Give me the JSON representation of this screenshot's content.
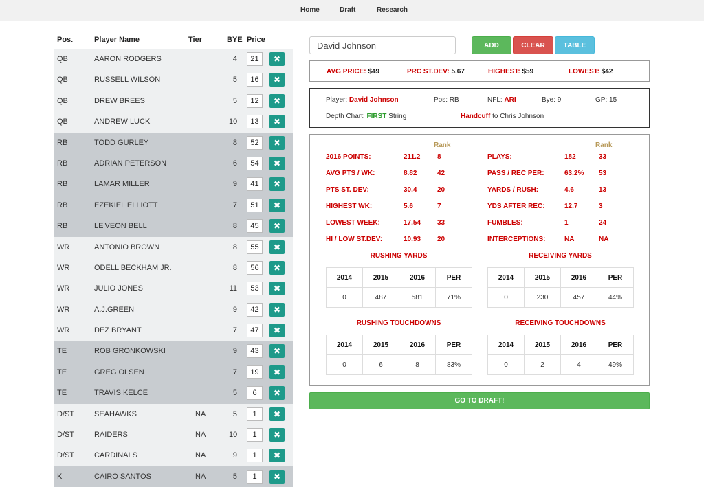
{
  "nav": {
    "home": "Home",
    "draft": "Draft",
    "research": "Research"
  },
  "table": {
    "headers": {
      "pos": "Pos.",
      "name": "Player Name",
      "tier": "Tier",
      "bye": "BYE",
      "price": "Price"
    },
    "delete_icon": "close-x-icon",
    "rows": [
      {
        "pos": "QB",
        "name": "AARON RODGERS",
        "tier": "",
        "bye": "4",
        "price": "21"
      },
      {
        "pos": "QB",
        "name": "RUSSELL WILSON",
        "tier": "",
        "bye": "5",
        "price": "16"
      },
      {
        "pos": "QB",
        "name": "DREW BREES",
        "tier": "",
        "bye": "5",
        "price": "12"
      },
      {
        "pos": "QB",
        "name": "ANDREW LUCK",
        "tier": "",
        "bye": "10",
        "price": "13"
      },
      {
        "pos": "RB",
        "name": "TODD GURLEY",
        "tier": "",
        "bye": "8",
        "price": "52"
      },
      {
        "pos": "RB",
        "name": "ADRIAN PETERSON",
        "tier": "",
        "bye": "6",
        "price": "54"
      },
      {
        "pos": "RB",
        "name": "LAMAR MILLER",
        "tier": "",
        "bye": "9",
        "price": "41"
      },
      {
        "pos": "RB",
        "name": "EZEKIEL ELLIOTT",
        "tier": "",
        "bye": "7",
        "price": "51"
      },
      {
        "pos": "RB",
        "name": "LE'VEON BELL",
        "tier": "",
        "bye": "8",
        "price": "45"
      },
      {
        "pos": "WR",
        "name": "ANTONIO BROWN",
        "tier": "",
        "bye": "8",
        "price": "55"
      },
      {
        "pos": "WR",
        "name": "ODELL BECKHAM JR.",
        "tier": "",
        "bye": "8",
        "price": "56"
      },
      {
        "pos": "WR",
        "name": "JULIO JONES",
        "tier": "",
        "bye": "11",
        "price": "53"
      },
      {
        "pos": "WR",
        "name": "A.J.GREEN",
        "tier": "",
        "bye": "9",
        "price": "42"
      },
      {
        "pos": "WR",
        "name": "DEZ BRYANT",
        "tier": "",
        "bye": "7",
        "price": "47"
      },
      {
        "pos": "TE",
        "name": "ROB GRONKOWSKI",
        "tier": "",
        "bye": "9",
        "price": "43"
      },
      {
        "pos": "TE",
        "name": "GREG OLSEN",
        "tier": "",
        "bye": "7",
        "price": "19"
      },
      {
        "pos": "TE",
        "name": "TRAVIS KELCE",
        "tier": "",
        "bye": "5",
        "price": "6"
      },
      {
        "pos": "D/ST",
        "name": "SEAHAWKS",
        "tier": "NA",
        "bye": "5",
        "price": "1"
      },
      {
        "pos": "D/ST",
        "name": "RAIDERS",
        "tier": "NA",
        "bye": "10",
        "price": "1"
      },
      {
        "pos": "D/ST",
        "name": "CARDINALS",
        "tier": "NA",
        "bye": "9",
        "price": "1"
      },
      {
        "pos": "K",
        "name": "CAIRO SANTOS",
        "tier": "NA",
        "bye": "5",
        "price": "1"
      }
    ]
  },
  "search": {
    "value": "David Johnson"
  },
  "buttons": {
    "add": "ADD",
    "clear": "CLEAR",
    "table": "TABLE",
    "go_to_draft": "GO TO DRAFT!"
  },
  "summary": {
    "avg_price_label": "AVG PRICE:",
    "avg_price": "$49",
    "prc_stdev_label": "PRC ST.DEV:",
    "prc_stdev": "5.67",
    "highest_label": "HIGHEST:",
    "highest": "$59",
    "lowest_label": "LOWEST:",
    "lowest": "$42"
  },
  "player_info": {
    "player_label": "Player:",
    "player": "David Johnson",
    "pos_label": "Pos:",
    "pos": "RB",
    "nfl_label": "NFL:",
    "nfl": "ARI",
    "bye_label": "Bye:",
    "bye": "9",
    "gp_label": "GP:",
    "gp": "15",
    "depth_label": "Depth Chart:",
    "depth": "FIRST",
    "depth_suffix": "String",
    "handcuff_label": "Handcuff",
    "handcuff_suffix": "to Chris Johnson"
  },
  "stats": {
    "rank_header": "Rank",
    "left": [
      {
        "label": "2016 POINTS:",
        "value": "211.2",
        "rank": "8"
      },
      {
        "label": "AVG PTS / WK:",
        "value": "8.82",
        "rank": "42"
      },
      {
        "label": "PTS ST. DEV:",
        "value": "30.4",
        "rank": "20"
      },
      {
        "label": "HIGHEST WK:",
        "value": "5.6",
        "rank": "7"
      },
      {
        "label": "LOWEST WEEK:",
        "value": "17.54",
        "rank": "33"
      },
      {
        "label": "HI / LOW ST.DEV:",
        "value": "10.93",
        "rank": "20"
      }
    ],
    "right": [
      {
        "label": "PLAYS:",
        "value": "182",
        "rank": "33"
      },
      {
        "label": "PASS / REC PER:",
        "value": "63.2%",
        "rank": "53"
      },
      {
        "label": "YARDS / RUSH:",
        "value": "4.6",
        "rank": "13"
      },
      {
        "label": "YDS AFTER REC:",
        "value": "12.7",
        "rank": "3"
      },
      {
        "label": "FUMBLES:",
        "value": "1",
        "rank": "24"
      },
      {
        "label": "INTERCEPTIONS:",
        "value": "NA",
        "rank": "NA"
      }
    ]
  },
  "mini_tables": [
    {
      "title": "RUSHING YARDS",
      "headers": [
        "2014",
        "2015",
        "2016",
        "PER"
      ],
      "values": [
        "0",
        "487",
        "581",
        "71%"
      ]
    },
    {
      "title": "RECEIVING YARDS",
      "headers": [
        "2014",
        "2015",
        "2016",
        "PER"
      ],
      "values": [
        "0",
        "230",
        "457",
        "44%"
      ]
    },
    {
      "title": "RUSHING TOUCHDOWNS",
      "headers": [
        "2014",
        "2015",
        "2016",
        "PER"
      ],
      "values": [
        "0",
        "6",
        "8",
        "83%"
      ]
    },
    {
      "title": "RECEIVING TOUCHDOWNS",
      "headers": [
        "2014",
        "2015",
        "2016",
        "PER"
      ],
      "values": [
        "0",
        "2",
        "4",
        "49%"
      ]
    }
  ]
}
